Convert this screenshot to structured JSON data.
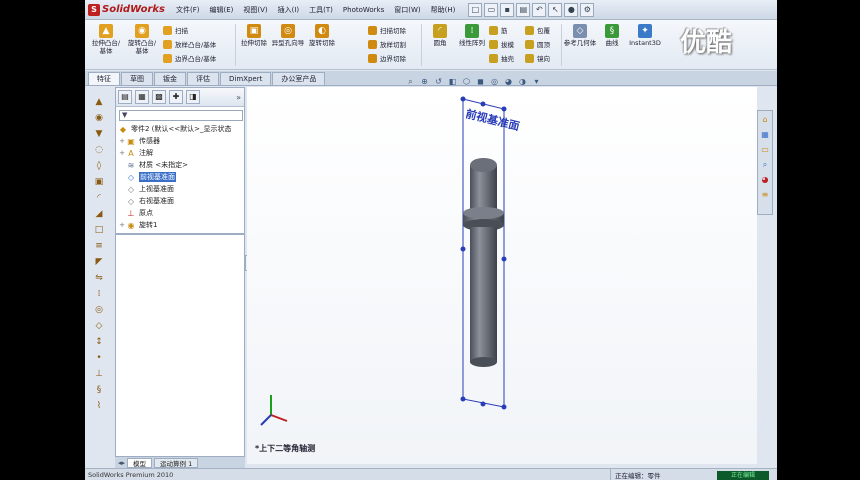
{
  "app": {
    "logo": "SolidWorks",
    "status_left": "SolidWorks Premium 2010",
    "status_right": "正在编辑：零件",
    "status_badge": "正在编辑"
  },
  "menu": [
    "文件(F)",
    "编辑(E)",
    "视图(V)",
    "插入(I)",
    "工具(T)",
    "PhotoWorks",
    "窗口(W)",
    "帮助(H)"
  ],
  "ribbon": {
    "big": [
      "拉伸凸台/基体",
      "旋转凸台/基体",
      "拉伸切除",
      "异型孔向导",
      "旋转切除",
      "圆角",
      "线性阵列",
      "参考几何体",
      "曲线",
      "Instant3D"
    ],
    "small": [
      "扫描",
      "放样凸台/基体",
      "边界凸台/基体",
      "扫描切除",
      "放样切割",
      "边界切除",
      "筋",
      "拔模",
      "抽壳",
      "包覆",
      "圆顶",
      "镜向"
    ]
  },
  "watermark": "优酷",
  "tabs": [
    "特征",
    "草图",
    "钣金",
    "评估",
    "DimXpert",
    "办公室产品"
  ],
  "feature_tree": {
    "filter_placeholder": "▼",
    "root": "零件2  (默认<<默认>_显示状态",
    "items": [
      {
        "label": "传感器",
        "icon": "sensor-icon",
        "expandable": true
      },
      {
        "label": "注解",
        "icon": "annotation-icon",
        "expandable": true
      },
      {
        "label": "材质 <未指定>",
        "icon": "material-icon",
        "expandable": false
      },
      {
        "label": "前视基准面",
        "icon": "plane-icon",
        "expandable": false,
        "selected": true
      },
      {
        "label": "上视基准面",
        "icon": "plane-icon",
        "expandable": false
      },
      {
        "label": "右视基准面",
        "icon": "plane-icon",
        "expandable": false
      },
      {
        "label": "原点",
        "icon": "origin-icon",
        "expandable": false
      },
      {
        "label": "旋转1",
        "icon": "revolve-icon",
        "expandable": true
      }
    ]
  },
  "bottom_tabs": [
    "模型",
    "运动算例 1"
  ],
  "viewport": {
    "plane_label": "前视基准面",
    "view_label": "*上下二等角轴测"
  }
}
